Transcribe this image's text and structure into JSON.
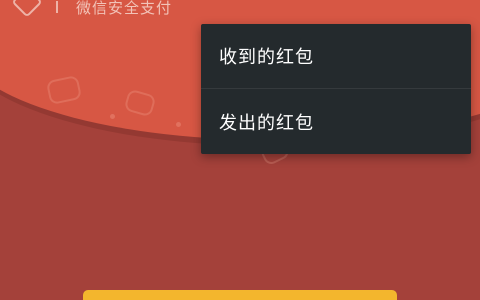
{
  "brand": {
    "text": "微信安全支付"
  },
  "menu": {
    "items": [
      {
        "label": "收到的红包"
      },
      {
        "label": "发出的红包"
      }
    ]
  },
  "colors": {
    "background": "#a4413a",
    "header": "#d75744",
    "menu": "#242a2d",
    "button": "#f3b62d"
  }
}
